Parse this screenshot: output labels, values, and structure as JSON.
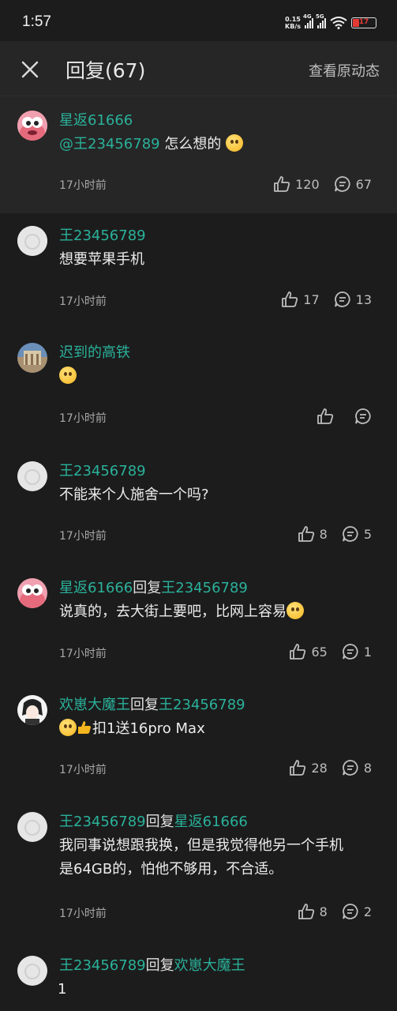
{
  "status": {
    "time": "1:57",
    "net_speed_top": "0.15",
    "net_speed_bottom": "KB/s",
    "sig1_label": "4G",
    "sig2_label": "5G",
    "battery": "17"
  },
  "header": {
    "title": "回复(67)",
    "original_link": "查看原动态"
  },
  "main_comment": {
    "user": "星返61666",
    "mention": "@王23456789",
    "text": " 怎么想的",
    "time": "17小时前",
    "likes": "120",
    "replies": "67"
  },
  "replies": [
    {
      "user": "王23456789",
      "reply_word": "",
      "reply_to": "",
      "text": "想要苹果手机",
      "time": "17小时前",
      "likes": "17",
      "replies": "13"
    },
    {
      "user": "迟到的高铁",
      "reply_word": "",
      "reply_to": "",
      "text": "",
      "time": "17小时前",
      "likes": "",
      "replies": ""
    },
    {
      "user": "王23456789",
      "reply_word": "",
      "reply_to": "",
      "text": "不能来个人施舍一个吗?",
      "time": "17小时前",
      "likes": "8",
      "replies": "5"
    },
    {
      "user": "星返61666",
      "reply_word": "回复",
      "reply_to": "王23456789",
      "text": "说真的，去大街上要吧，比网上容易",
      "time": "17小时前",
      "likes": "65",
      "replies": "1"
    },
    {
      "user": "欢崽大魔王",
      "reply_word": "回复",
      "reply_to": "王23456789",
      "text": "扣1送16pro Max",
      "time": "17小时前",
      "likes": "28",
      "replies": "8"
    },
    {
      "user": "王23456789",
      "reply_word": "回复",
      "reply_to": "星返61666",
      "text_line1": "我同事说想跟我换，但是我觉得他另一个手机",
      "text_line2": "是64GB的，怕他不够用，不合适。",
      "time": "17小时前",
      "likes": "8",
      "replies": "2"
    },
    {
      "user": "王23456789",
      "reply_word": "回复",
      "reply_to": "欢崽大魔王",
      "text": "1"
    }
  ],
  "colors": {
    "accent": "#2ab19a",
    "background": "#1c1c1c",
    "header_bg": "#262626"
  }
}
